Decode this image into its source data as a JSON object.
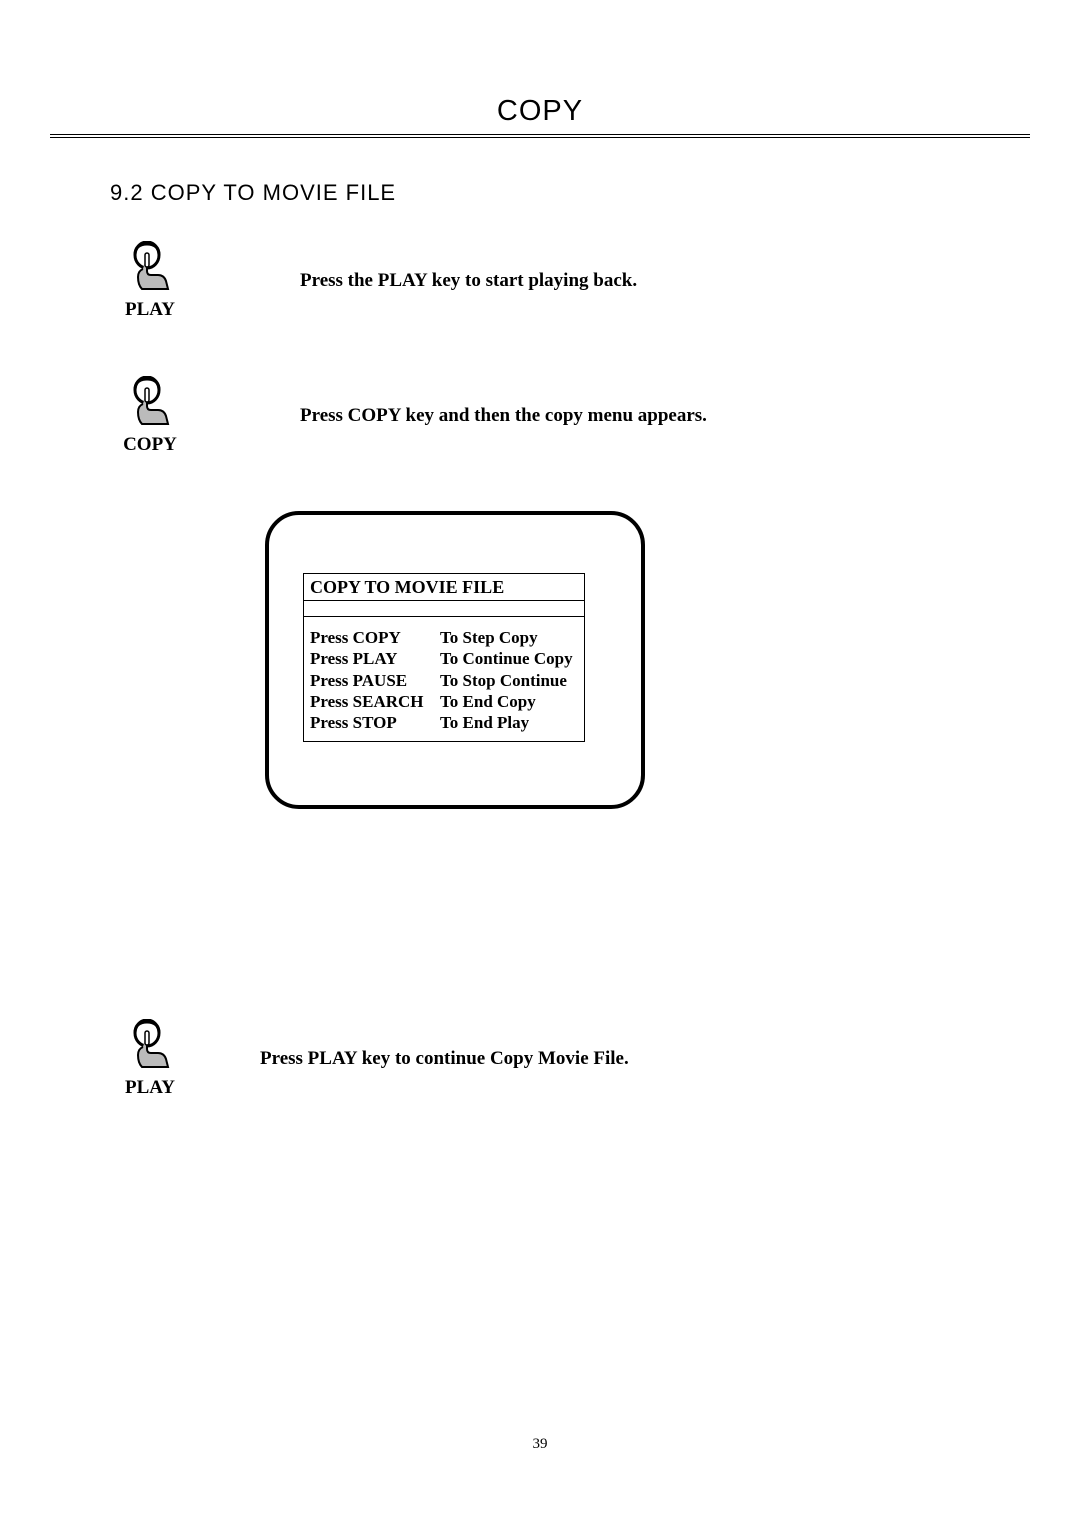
{
  "header": {
    "title": "COPY"
  },
  "section": {
    "heading": "9.2 COPY TO MOVIE FILE"
  },
  "steps": {
    "step1": {
      "key_label": "PLAY",
      "text": "Press the PLAY key to start  playing back."
    },
    "step2": {
      "key_label": "COPY",
      "text": "Press COPY key and then the copy menu  appears."
    },
    "step3": {
      "key_label": "PLAY",
      "text": "Press PLAY key to continue Copy Movie File."
    }
  },
  "menu": {
    "title": "COPY TO MOVIE FILE",
    "rows": [
      {
        "key": "Press COPY",
        "action": "To Step Copy"
      },
      {
        "key": "Press PLAY",
        "action": "To Continue Copy"
      },
      {
        "key": "Press PAUSE",
        "action": "To Stop Continue"
      },
      {
        "key": "Press SEARCH",
        "action": "To End Copy"
      },
      {
        "key": "Press STOP",
        "action": "To End Play"
      }
    ]
  },
  "footer": {
    "page_number": "39"
  }
}
